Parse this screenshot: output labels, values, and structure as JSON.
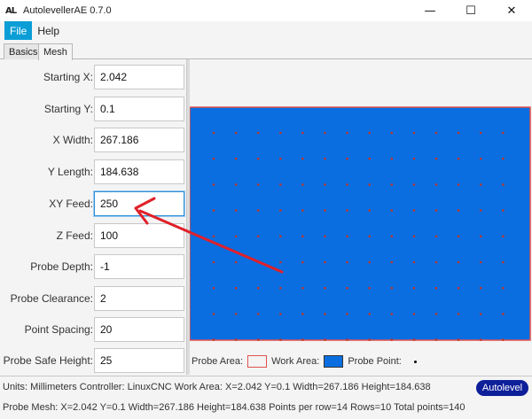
{
  "window": {
    "logo": "AL",
    "title": "AutolevellerAE 0.7.0",
    "controls": {
      "minimize": "—",
      "maximize": "☐",
      "close": "✕"
    }
  },
  "menu": {
    "items": [
      "File",
      "Help"
    ],
    "active": "File"
  },
  "tabs": [
    "Basics",
    "Mesh"
  ],
  "selected_tab": "Mesh",
  "form": {
    "starting_x": {
      "label": "Starting X:",
      "value": "2.042"
    },
    "starting_y": {
      "label": "Starting Y:",
      "value": "0.1"
    },
    "x_width": {
      "label": "X Width:",
      "value": "267.186"
    },
    "y_length": {
      "label": "Y Length:",
      "value": "184.638"
    },
    "xy_feed": {
      "label": "XY Feed:",
      "value": "250"
    },
    "z_feed": {
      "label": "Z Feed:",
      "value": "100"
    },
    "probe_depth": {
      "label": "Probe Depth:",
      "value": "-1"
    },
    "probe_clearance": {
      "label": "Probe Clearance:",
      "value": "2"
    },
    "point_spacing": {
      "label": "Point Spacing:",
      "value": "20"
    },
    "probe_safe_height": {
      "label": "Probe Safe Height:",
      "value": "25"
    }
  },
  "preview": {
    "points_per_row": 14,
    "rows": 10,
    "work_area_color": "#0a6ee0",
    "probe_area_color": "#e05050",
    "point_color": "#c0392b",
    "annotation_arrow_color": "#e0202a"
  },
  "legend": {
    "probe_area": "Probe Area:",
    "work_area": "Work Area:",
    "probe_point": "Probe Point:"
  },
  "status": {
    "line1": "Units: Millimeters   Controller: LinuxCNC   Work Area: X=2.042 Y=0.1 Width=267.186 Height=184.638",
    "line2": "Probe Mesh: X=2.042 Y=0.1 Width=267.186 Height=184.638 Points per row=14 Rows=10 Total points=140"
  },
  "autolevel_button": "Autolevel"
}
